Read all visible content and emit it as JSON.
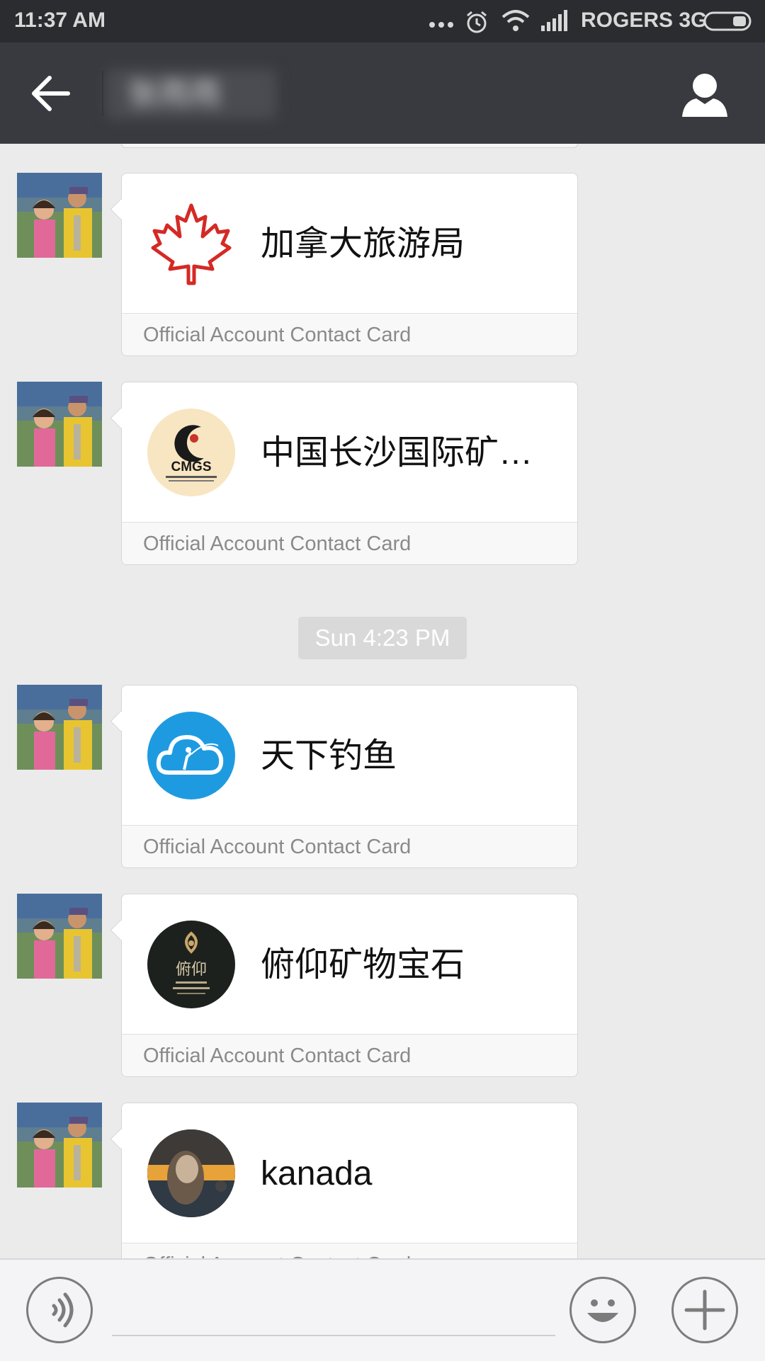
{
  "status_bar": {
    "time": "11:37 AM",
    "carrier": "ROGERS 3G"
  },
  "header": {
    "chat_title": "张雨雨"
  },
  "messages": [
    {
      "name": "加拿大旅游局",
      "footer": "Official Account Contact Card",
      "logo": "maple-leaf-logo"
    },
    {
      "name": "中国长沙国际矿物...",
      "footer": "Official Account Contact Card",
      "logo": "cmgs-logo"
    },
    {
      "name": "天下钓鱼",
      "footer": "Official Account Contact Card",
      "logo": "cloud-fisherman-logo"
    },
    {
      "name": "俯仰矿物宝石",
      "footer": "Official Account Contact Card",
      "logo": "fooyoung-mineral-logo"
    },
    {
      "name": "kanada",
      "footer": "Official Account Contact Card",
      "logo": "person-photo-avatar"
    }
  ],
  "timestamp": "Sun 4:23 PM",
  "logos": {
    "cmgs_text": "CMGS",
    "fooyoung_text": "俯仰"
  },
  "colors": {
    "status_bar_bg": "#2b2c30",
    "title_bar_bg": "#393a3f",
    "chat_bg": "#ebebeb",
    "maple_red": "#d42a25",
    "cloud_blue": "#1e9be0"
  }
}
